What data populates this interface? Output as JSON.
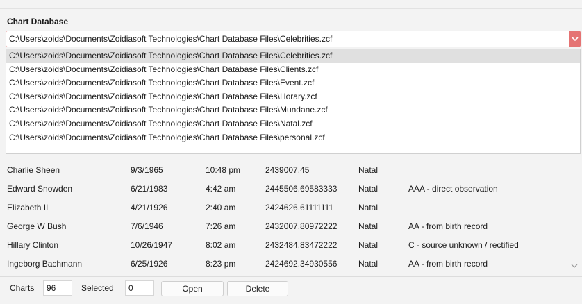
{
  "section_title": "Chart Database",
  "combo": {
    "value": "C:\\Users\\zoids\\Documents\\Zoidiasoft Technologies\\Chart Database Files\\Celebrities.zcf",
    "icon": "chevron-down-icon"
  },
  "dropdown": {
    "items": [
      "C:\\Users\\zoids\\Documents\\Zoidiasoft Technologies\\Chart Database Files\\Celebrities.zcf",
      "C:\\Users\\zoids\\Documents\\Zoidiasoft Technologies\\Chart Database Files\\Clients.zcf",
      "C:\\Users\\zoids\\Documents\\Zoidiasoft Technologies\\Chart Database Files\\Event.zcf",
      "C:\\Users\\zoids\\Documents\\Zoidiasoft Technologies\\Chart Database Files\\Horary.zcf",
      "C:\\Users\\zoids\\Documents\\Zoidiasoft Technologies\\Chart Database Files\\Mundane.zcf",
      "C:\\Users\\zoids\\Documents\\Zoidiasoft Technologies\\Chart Database Files\\Natal.zcf",
      "C:\\Users\\zoids\\Documents\\Zoidiasoft Technologies\\Chart Database Files\\personal.zcf"
    ],
    "selected_index": 0
  },
  "table": {
    "rows": [
      [
        "Charlie Sheen",
        "9/3/1965",
        "10:48 pm",
        "2439007.45",
        "Natal",
        ""
      ],
      [
        "Edward Snowden",
        "6/21/1983",
        "4:42 am",
        "2445506.69583333",
        "Natal",
        "AAA - direct observation"
      ],
      [
        "Elizabeth II",
        "4/21/1926",
        "2:40 am",
        "2424626.61111111",
        "Natal",
        ""
      ],
      [
        "George W Bush",
        "7/6/1946",
        "7:26 am",
        "2432007.80972222",
        "Natal",
        "AA - from birth record"
      ],
      [
        "Hillary Clinton",
        "10/26/1947",
        "8:02 am",
        "2432484.83472222",
        "Natal",
        "C - source unknown / rectified"
      ],
      [
        "Ingeborg Bachmann",
        "6/25/1926",
        "8:23 pm",
        "2424692.34930556",
        "Natal",
        "AA - from birth record"
      ]
    ]
  },
  "footer": {
    "charts_label": "Charts",
    "charts_value": "96",
    "selected_label": "Selected",
    "selected_value": "0",
    "open_label": "Open",
    "delete_label": "Delete"
  },
  "colors": {
    "accent": "#e57373",
    "selected_item": "#e0e0e0"
  }
}
